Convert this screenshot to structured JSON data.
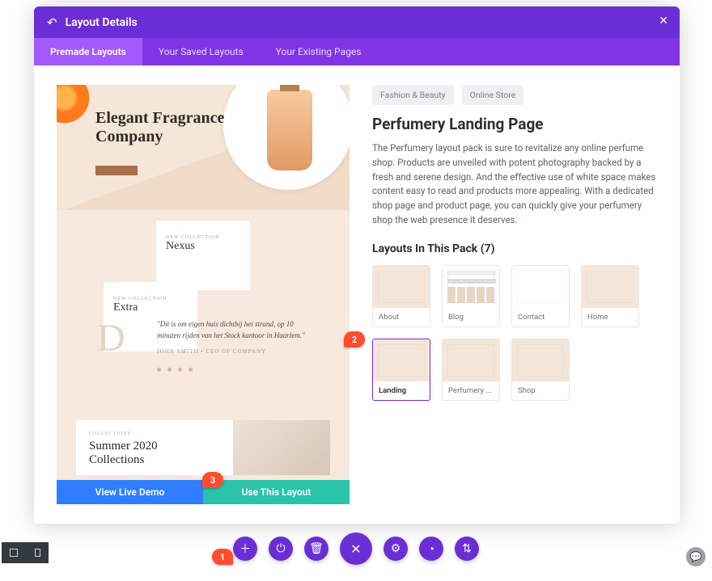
{
  "header": {
    "title": "Layout Details"
  },
  "tabs": [
    {
      "label": "Premade Layouts",
      "active": true
    },
    {
      "label": "Your Saved Layouts",
      "active": false
    },
    {
      "label": "Your Existing Pages",
      "active": false
    }
  ],
  "preview": {
    "hero_title_line1": "Elegant Fragrance",
    "hero_title_line2": "Company",
    "card1": "Nexus",
    "card2": "Extra",
    "quote": "\"Dit is om eigen huis dichtbij het strand, op 10 minuten rijden van het Stock kantoor in Haarlem.\"",
    "quote_author": "JOHN SMITH  •  CEO OF COMPANY",
    "summer_sub": "COLLECTIONS",
    "summer_h1": "Summer 2020",
    "summer_h2": "Collections",
    "demo_button": "View Live Demo",
    "use_button": "Use This Layout"
  },
  "details": {
    "tags": [
      "Fashion & Beauty",
      "Online Store"
    ],
    "title": "Perfumery Landing Page",
    "description": "The Perfumery layout pack is sure to revitalize any online perfume shop. Products are unveiled with potent photography backed by a fresh and serene design. And the effective use of white space makes content easy to read and products more appealing. With a dedicated shop page and product page, you can quickly give your perfumery shop the web presence it deserves.",
    "pack_heading": "Layouts In This Pack (7)",
    "layouts": [
      {
        "label": "About"
      },
      {
        "label": "Blog"
      },
      {
        "label": "Contact"
      },
      {
        "label": "Home"
      },
      {
        "label": "Landing",
        "selected": true
      },
      {
        "label": "Perfumery ..."
      },
      {
        "label": "Shop"
      }
    ]
  },
  "markers": {
    "m1": "1",
    "m2": "2",
    "m3": "3"
  }
}
